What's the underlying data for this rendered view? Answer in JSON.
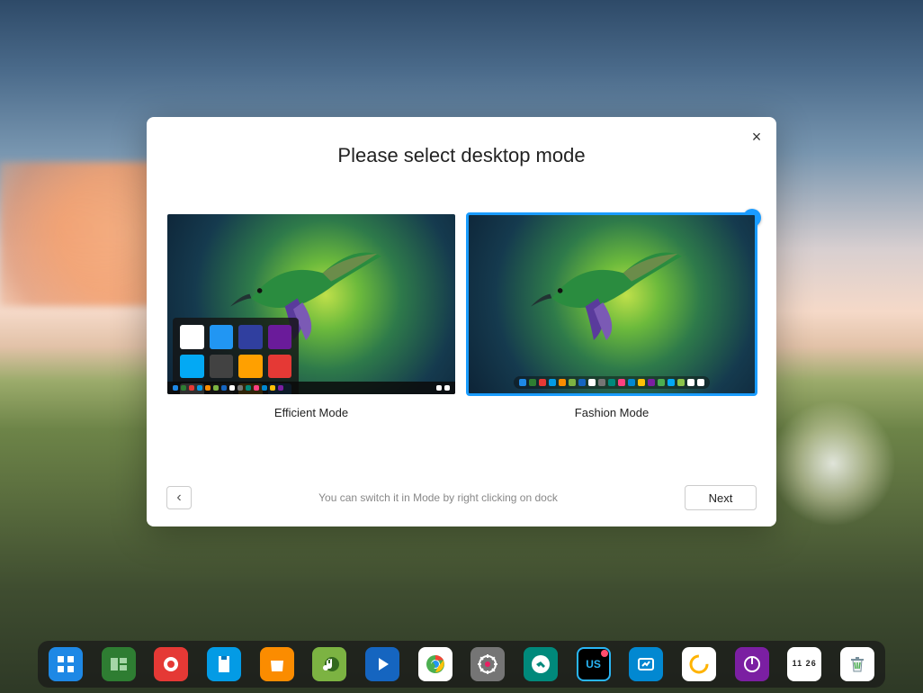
{
  "modal": {
    "title": "Please select desktop mode",
    "options": [
      {
        "label": "Efficient Mode",
        "selected": false
      },
      {
        "label": "Fashion Mode",
        "selected": true
      }
    ],
    "hint": "You can switch it in Mode by right clicking on dock",
    "back_glyph": "‹",
    "next_label": "Next",
    "close_glyph": "×"
  },
  "dock": {
    "items": [
      {
        "name": "launcher"
      },
      {
        "name": "multitask"
      },
      {
        "name": "screen-recorder"
      },
      {
        "name": "file-manager"
      },
      {
        "name": "app-store"
      },
      {
        "name": "music"
      },
      {
        "name": "video-player"
      },
      {
        "name": "browser"
      },
      {
        "name": "control-center"
      },
      {
        "name": "remote-assistance"
      },
      {
        "name": "keyboard-layout",
        "text": "US",
        "badge": true
      },
      {
        "name": "screenshot"
      },
      {
        "name": "system-monitor"
      },
      {
        "name": "power"
      },
      {
        "name": "datetime",
        "text": "11 26"
      },
      {
        "name": "trash"
      }
    ]
  }
}
